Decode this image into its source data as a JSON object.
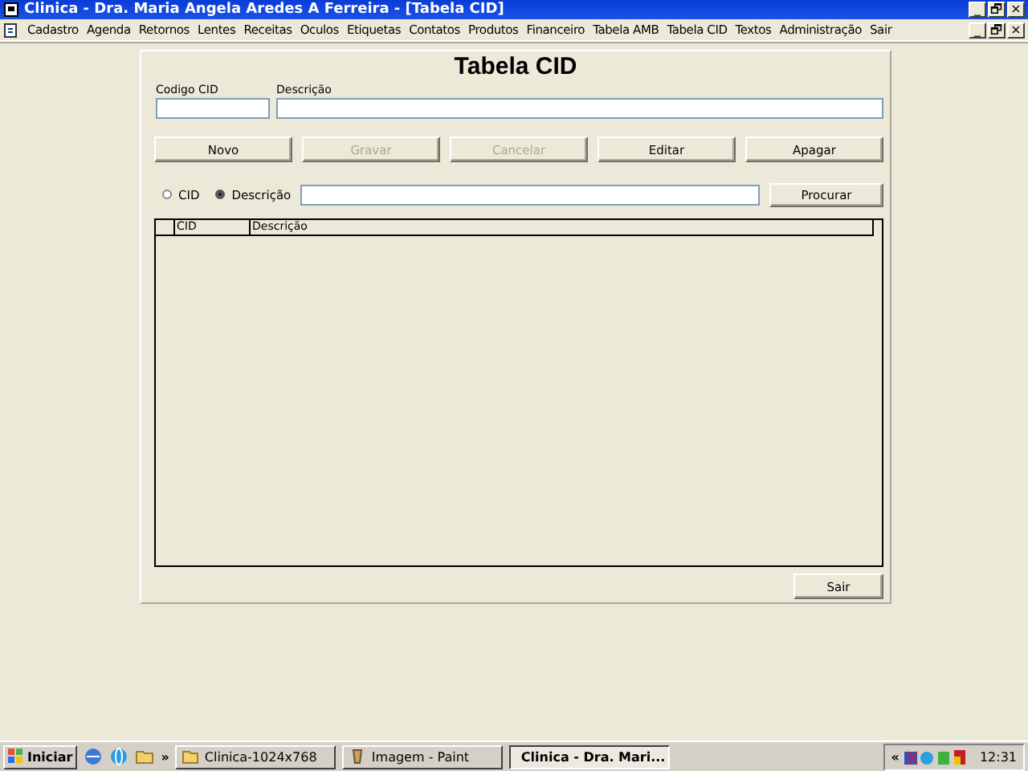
{
  "window": {
    "title": "Clinica - Dra. Maria Angela Aredes A Ferreira - [Tabela CID]",
    "controls": [
      "_",
      "🗗",
      "×"
    ]
  },
  "menu": {
    "controls": [
      "_",
      "🗗",
      "×"
    ],
    "items": [
      "Cadastro",
      "Agenda",
      "Retornos",
      "Lentes",
      "Receitas",
      "Oculos",
      "Etiquetas",
      "Contatos",
      "Produtos",
      "Financeiro",
      "Tabela AMB",
      "Tabela CID",
      "Textos",
      "Administração",
      "Sair"
    ]
  },
  "form": {
    "title": "Tabela CID",
    "fields": [
      {
        "label": "Codigo CID"
      },
      {
        "label": "Descrição"
      }
    ],
    "buttons": [
      {
        "label": "Novo",
        "disabled": false
      },
      {
        "label": "Gravar",
        "disabled": true
      },
      {
        "label": "Cancelar",
        "disabled": true
      },
      {
        "label": "Editar",
        "disabled": false
      },
      {
        "label": "Apagar",
        "disabled": false
      }
    ],
    "search": {
      "options": [
        {
          "label": "CID",
          "selected": false
        },
        {
          "label": "Descrição",
          "selected": true
        }
      ],
      "button": "Procurar"
    },
    "table": {
      "columns": [
        "CID",
        "Descrição"
      ]
    },
    "exit_button": "Sair"
  },
  "taskbar": {
    "start": "Iniciar",
    "more": "»",
    "tasks": [
      {
        "label": "Clinica-1024x768",
        "selected": false,
        "kind": "folder"
      },
      {
        "label": "Imagem - Paint",
        "selected": false,
        "kind": "paint"
      },
      {
        "label": "Clinica - Dra. Mari...",
        "selected": true,
        "kind": "app"
      }
    ],
    "tray_more": "«",
    "clock": "12:31"
  }
}
